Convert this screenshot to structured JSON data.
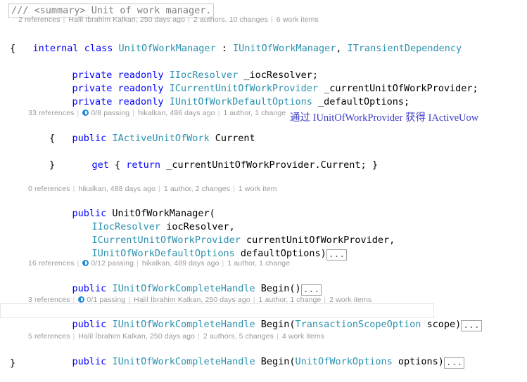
{
  "editor": {
    "language": "csharp",
    "colors": {
      "keyword": "#0000FF",
      "type": "#2B91AF",
      "comment": "#808080",
      "text": "#000000",
      "codelens": "#9A9A9A",
      "annotation": "#3C3CC8",
      "background": "#FFFFFF",
      "test_status": "#1F8AD2"
    },
    "doc_comment": "/// <summary> Unit of work manager.",
    "collapsed_block_label": "...",
    "annotation": {
      "text": "通过 IUnitOfWorkProvider 获得 IActiveUow"
    },
    "codelens": {
      "class": {
        "references": "2 references",
        "author_date": "Halil İbrahim Kalkan, 250 days ago",
        "changes": "2 authors, 10 changes",
        "work_items": "6 work items"
      },
      "current_property": {
        "references": "33 references",
        "tests": "0/8 passing",
        "author_date": "hikalkan, 496 days ago",
        "changes": "1 author, 1 change"
      },
      "constructor": {
        "references": "0 references",
        "author_date": "hikalkan, 488 days ago",
        "changes": "1 author, 2 changes",
        "work_items": "1 work item"
      },
      "begin_noargs": {
        "references": "16 references",
        "tests": "0/12 passing",
        "author_date": "hikalkan, 489 days ago",
        "changes": "1 author, 1 change"
      },
      "begin_scope": {
        "references": "3 references",
        "tests": "0/1 passing",
        "author_date": "Halil İbrahim Kalkan, 250 days ago",
        "changes": "1 author, 1 change",
        "work_items": "2 work items"
      },
      "begin_options": {
        "references": "5 references",
        "author_date": "Halil İbrahim Kalkan, 250 days ago",
        "changes": "2 authors, 5 changes",
        "work_items": "4 work items"
      }
    },
    "code": {
      "class_decl": {
        "kw_internal": "internal",
        "kw_class": "class",
        "name": "UnitOfWorkManager",
        "colon": " : ",
        "base1": "IUnitOfWorkManager",
        "comma": ", ",
        "base2": "ITransientDependency"
      },
      "open_brace": "{",
      "close_brace": "}",
      "field1": {
        "kw": "private readonly",
        "type": "IIocResolver",
        "name": " _iocResolver;"
      },
      "field2": {
        "kw": "private readonly",
        "type": "ICurrentUnitOfWorkProvider",
        "name": " _currentUnitOfWorkProvider;"
      },
      "field3": {
        "kw": "private readonly",
        "type": "IUnitOfWorkDefaultOptions",
        "name": " _defaultOptions;"
      },
      "current_prop": {
        "kw": "public",
        "type": "IActiveUnitOfWork",
        "name": " Current",
        "open": "{",
        "getter_kw_get": "get",
        "getter_open": " { ",
        "getter_kw_return": "return",
        "getter_expr": " _currentUnitOfWorkProvider.Current; ",
        "getter_close": "}",
        "close": "}"
      },
      "ctor": {
        "kw": "public",
        "name": " UnitOfWorkManager(",
        "p1_type": "IIocResolver",
        "p1_name": " iocResolver,",
        "p2_type": "ICurrentUnitOfWorkProvider",
        "p2_name": " currentUnitOfWorkProvider,",
        "p3_type": "IUnitOfWorkDefaultOptions",
        "p3_name": " defaultOptions)"
      },
      "begin_noargs": {
        "kw": "public",
        "type": "IUnitOfWorkCompleteHandle",
        "name": " Begin()"
      },
      "begin_scope": {
        "kw": "public",
        "type": "IUnitOfWorkCompleteHandle",
        "name": " Begin(",
        "param_type": "TransactionScopeOption",
        "param_name": " scope)"
      },
      "begin_options": {
        "kw": "public",
        "type": "IUnitOfWorkCompleteHandle",
        "name": " Begin(",
        "param_type": "UnitOfWorkOptions",
        "param_name": " options)"
      }
    }
  }
}
